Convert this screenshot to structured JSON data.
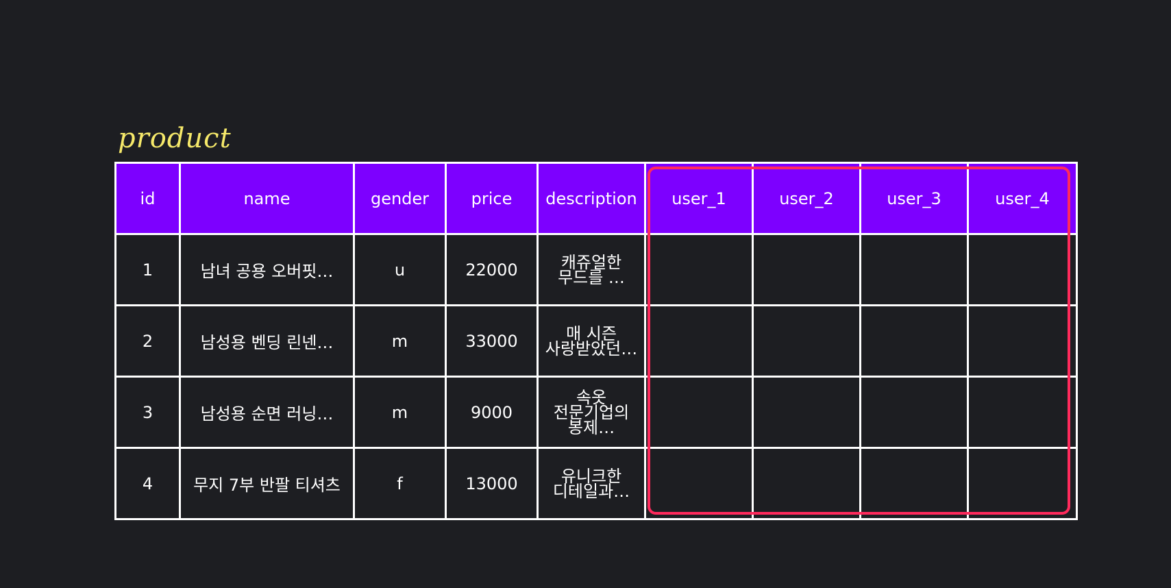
{
  "title": "product",
  "columns": [
    "id",
    "name",
    "gender",
    "price",
    "description",
    "user_1",
    "user_2",
    "user_3",
    "user_4"
  ],
  "rows": [
    {
      "id": "1",
      "name": "남녀 공용 오버핏…",
      "gender": "u",
      "price": "22000",
      "description": "캐쥬얼한 무드를 …",
      "user_1": "",
      "user_2": "",
      "user_3": "",
      "user_4": ""
    },
    {
      "id": "2",
      "name": "남성용 벤딩 린넨…",
      "gender": "m",
      "price": "33000",
      "description": "매 시즌 사랑받았던…",
      "user_1": "",
      "user_2": "",
      "user_3": "",
      "user_4": ""
    },
    {
      "id": "3",
      "name": "남성용 순면 러닝…",
      "gender": "m",
      "price": "9000",
      "description": "속옷 전문기업의 봉제…",
      "user_1": "",
      "user_2": "",
      "user_3": "",
      "user_4": ""
    },
    {
      "id": "4",
      "name": "무지 7부 반팔 티셔츠",
      "gender": "f",
      "price": "13000",
      "description": "유니크한 디테일과…",
      "user_1": "",
      "user_2": "",
      "user_3": "",
      "user_4": ""
    }
  ],
  "colors": {
    "background": "#1d1e22",
    "header": "#7d00ff",
    "title": "#f6e96a",
    "highlight": "#ff2a5c",
    "grid": "#ffffff"
  }
}
